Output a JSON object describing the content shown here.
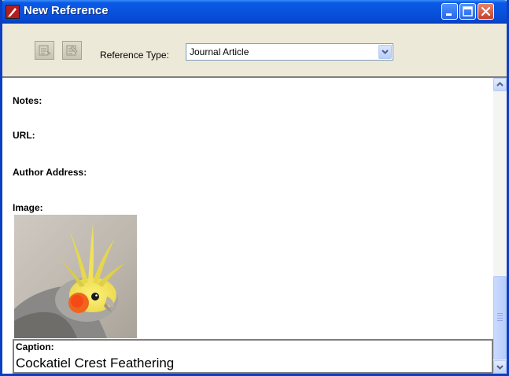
{
  "window": {
    "title": "New Reference",
    "title_bar_color": "#0a5ae6"
  },
  "toolbar": {
    "reference_type_label": "Reference Type:",
    "reference_type_value": "Journal Article"
  },
  "fields": {
    "notes_label": "Notes:",
    "url_label": "URL:",
    "author_address_label": "Author Address:",
    "image_label": "Image:"
  },
  "caption": {
    "label": "Caption:",
    "value": "Cockatiel Crest Feathering"
  },
  "icons": {
    "app": "endnote-app-icon",
    "minimize": "minimize-icon",
    "maximize": "maximize-icon",
    "close": "close-icon",
    "tool1": "reference-tool-icon",
    "tool2": "reference-edit-icon",
    "scroll_up": "scroll-up-arrow-icon",
    "scroll_down": "scroll-down-arrow-icon"
  }
}
